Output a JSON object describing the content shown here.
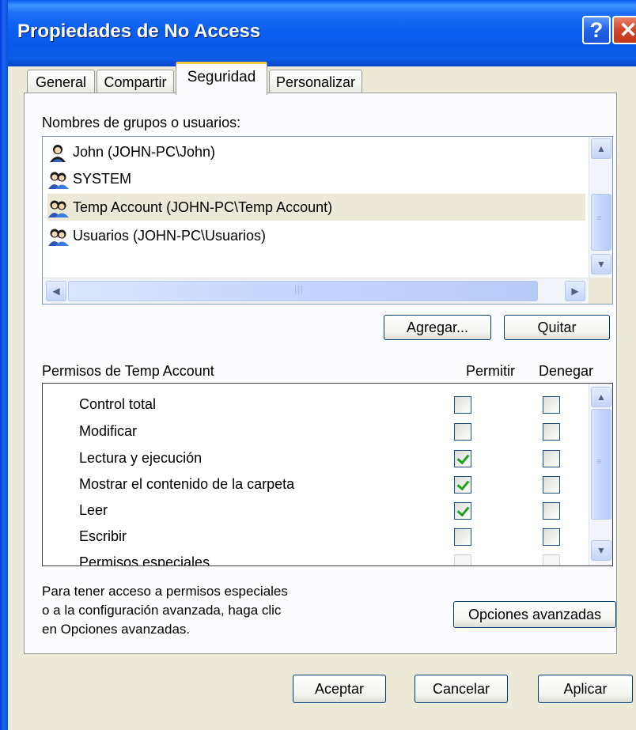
{
  "window": {
    "title": "Propiedades de No Access",
    "help_label": "?",
    "close_label": "✕"
  },
  "tabs": [
    {
      "label": "General"
    },
    {
      "label": "Compartir"
    },
    {
      "label": "Seguridad"
    },
    {
      "label": "Personalizar"
    }
  ],
  "users_section": {
    "label": "Nombres de grupos o usuarios:",
    "items": [
      {
        "label": "John (JOHN-PC\\John)",
        "icon": "user-icon"
      },
      {
        "label": "SYSTEM",
        "icon": "group-icon"
      },
      {
        "label": "Temp Account (JOHN-PC\\Temp Account)",
        "icon": "group-icon",
        "selected": true
      },
      {
        "label": "Usuarios (JOHN-PC\\Usuarios)",
        "icon": "group-icon"
      }
    ],
    "add_button": "Agregar...",
    "remove_button": "Quitar"
  },
  "permissions": {
    "label": "Permisos de Temp Account",
    "col_allow": "Permitir",
    "col_deny": "Denegar",
    "rows": [
      {
        "label": "Control total",
        "allow": false,
        "deny": false
      },
      {
        "label": "Modificar",
        "allow": false,
        "deny": false
      },
      {
        "label": "Lectura y ejecución",
        "allow": true,
        "deny": false
      },
      {
        "label": "Mostrar el contenido de la carpeta",
        "allow": true,
        "deny": false
      },
      {
        "label": "Leer",
        "allow": true,
        "deny": false
      },
      {
        "label": "Escribir",
        "allow": false,
        "deny": false
      },
      {
        "label": "Permisos especiales",
        "allow": false,
        "deny": false
      }
    ]
  },
  "advanced": {
    "text_line1": "Para tener acceso a permisos especiales",
    "text_line2": "o a la configuración avanzada, haga clic",
    "text_line3": "en Opciones avanzadas.",
    "button": "Opciones avanzadas"
  },
  "footer": {
    "ok": "Aceptar",
    "cancel": "Cancelar",
    "apply": "Aplicar"
  },
  "colors": {
    "titlebar": "#0a5ff0",
    "tab_highlight": "#ffc83c",
    "dialog_bg": "#ece9d8"
  }
}
